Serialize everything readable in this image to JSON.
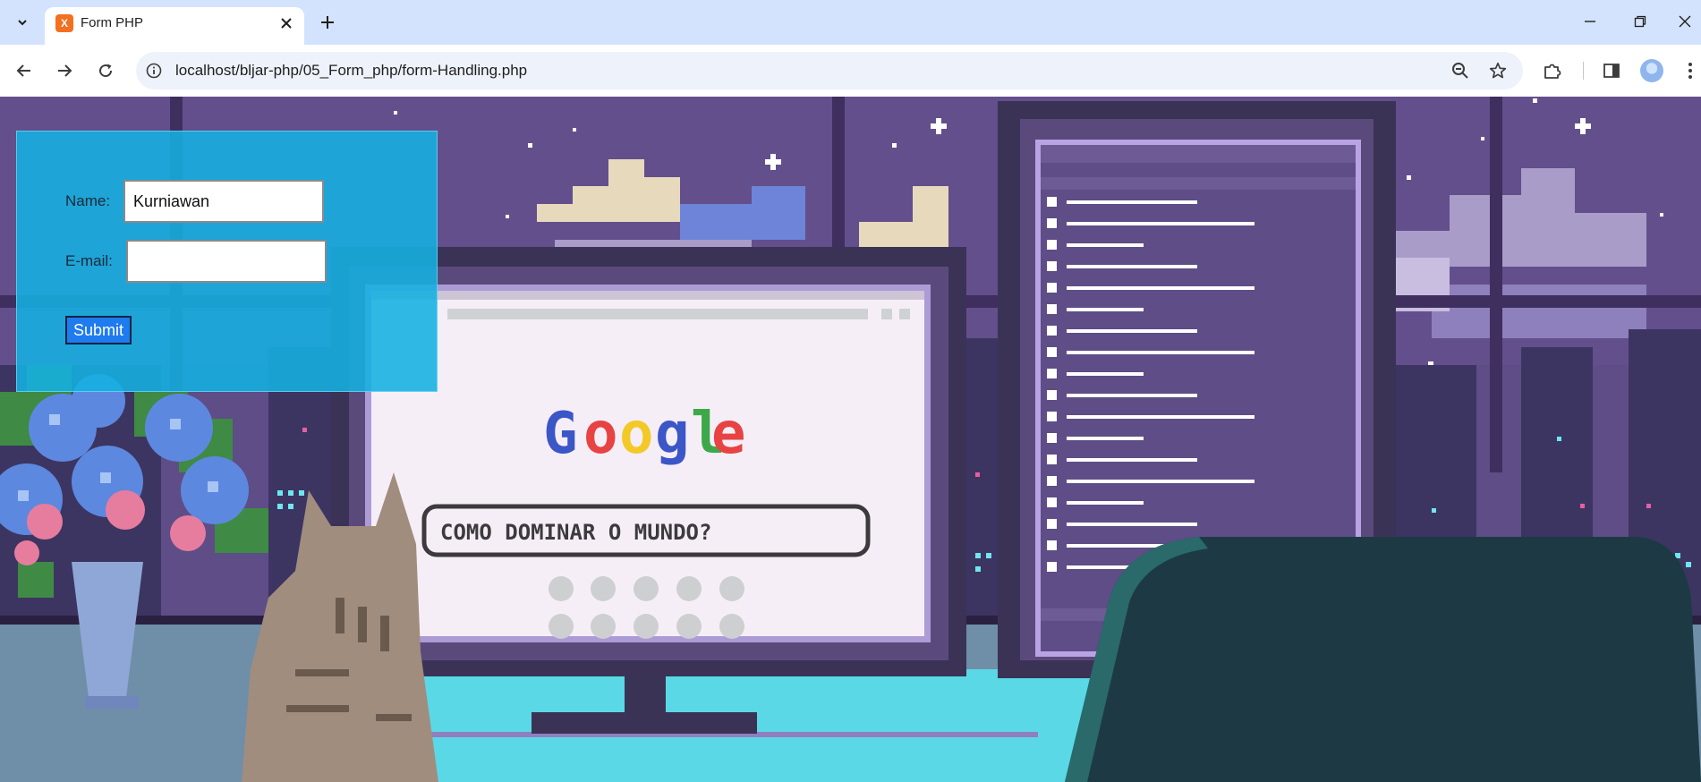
{
  "browser": {
    "tab_title": "Form PHP",
    "favicon_label": "X",
    "url": "localhost/bljar-php/05_Form_php/form-Handling.php",
    "icons": {
      "tab_list": "chevron-down-icon",
      "tab_close": "close-icon",
      "new_tab": "plus-icon",
      "back": "arrow-left-icon",
      "forward": "arrow-right-icon",
      "reload": "reload-icon",
      "site_info": "info-icon",
      "zoom": "zoom-out-icon",
      "bookmark": "star-icon",
      "extensions": "puzzle-icon",
      "side_panel": "side-panel-icon",
      "menu": "kebab-menu-icon",
      "minimize": "minimize-icon",
      "restore": "restore-icon",
      "window_close": "close-icon"
    }
  },
  "form": {
    "name_label": "Name:",
    "name_value": "Kurniawan",
    "email_label": "E-mail:",
    "email_value": "",
    "submit_label": "Submit"
  },
  "background": {
    "google_logo": [
      "G",
      "o",
      "o",
      "g",
      "l",
      "e"
    ],
    "search_text": "COMO DOMINAR O MUNDO?",
    "colors": {
      "sky": "#5e4d86",
      "panel": "#15b0e1",
      "desk": "#5ad8e6",
      "chair": "#1d3a44"
    }
  }
}
